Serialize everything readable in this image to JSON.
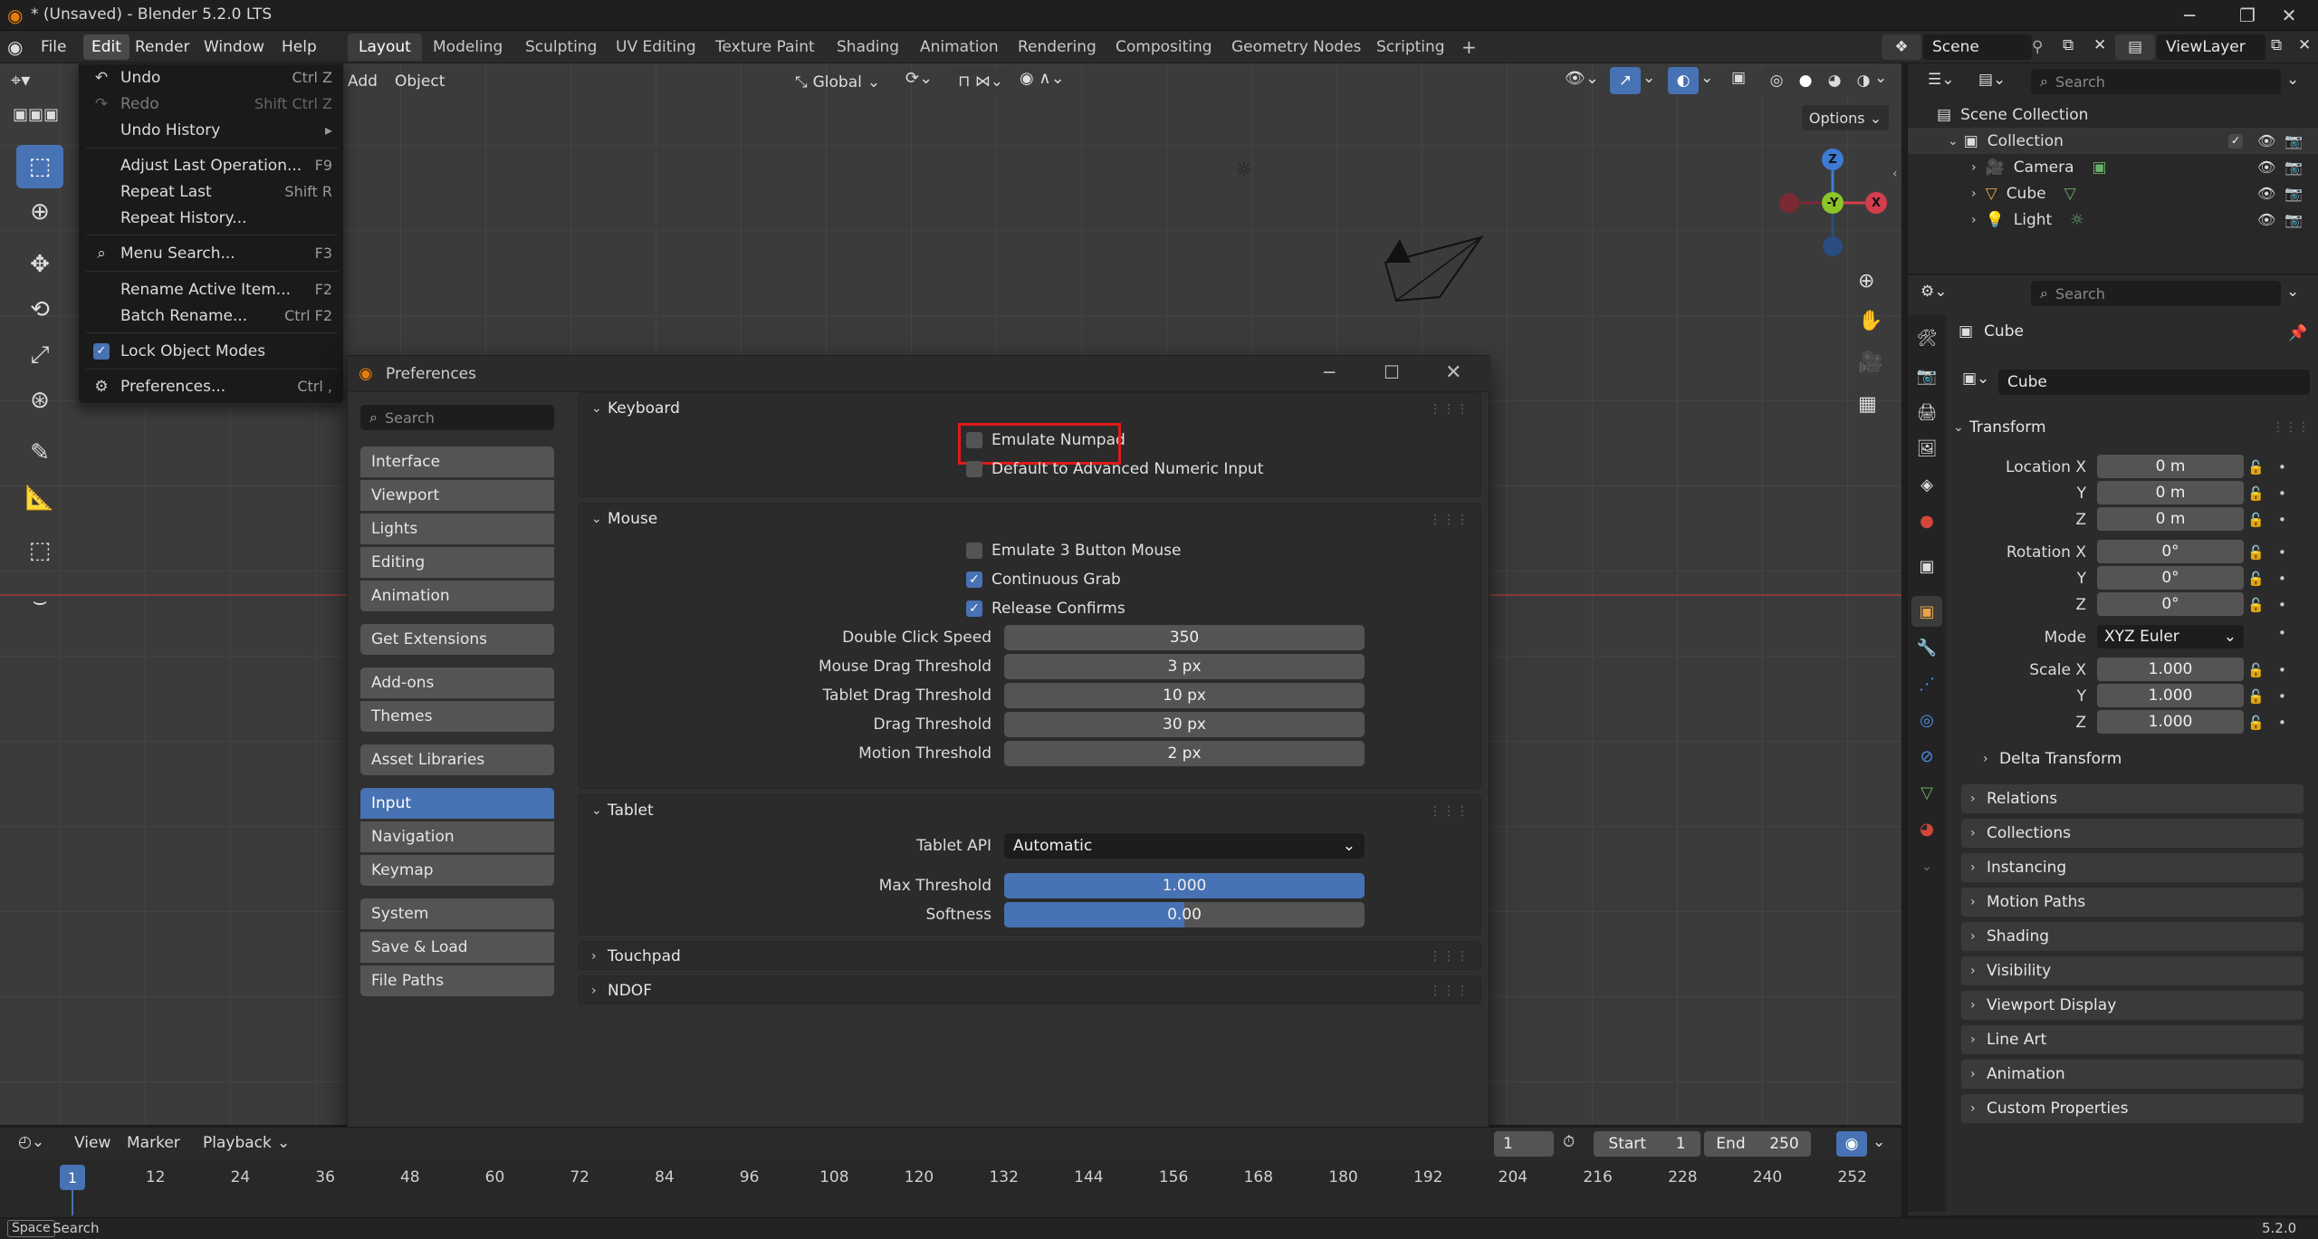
{
  "window": {
    "title": "* (Unsaved) - Blender 5.2.0 LTS"
  },
  "menubar": {
    "items": [
      "File",
      "Edit",
      "Render",
      "Window",
      "Help"
    ]
  },
  "workspaces": [
    "Layout",
    "Modeling",
    "Sculpting",
    "UV Editing",
    "Texture Paint",
    "Shading",
    "Animation",
    "Rendering",
    "Compositing",
    "Geometry Nodes",
    "Scripting"
  ],
  "scene": {
    "name": "Scene",
    "view_layer": "ViewLayer"
  },
  "viewport": {
    "header_menus": [
      "Add",
      "Object"
    ],
    "transform_orientation": "Global",
    "options_label": "Options",
    "gizmo": {
      "z": "Z",
      "y": "-Y",
      "x": "X"
    }
  },
  "edit_menu": {
    "items": [
      {
        "label": "Undo",
        "shortcut": "Ctrl Z",
        "icon": "undo-icon"
      },
      {
        "label": "Redo",
        "shortcut": "Shift Ctrl Z",
        "icon": "redo-icon",
        "disabled": true
      },
      {
        "label": "Undo History",
        "shortcut": "▸"
      },
      {
        "label": "Adjust Last Operation...",
        "shortcut": "F9"
      },
      {
        "label": "Repeat Last",
        "shortcut": "Shift R"
      },
      {
        "label": "Repeat History...",
        "shortcut": ""
      },
      {
        "label": "Menu Search...",
        "shortcut": "F3",
        "icon": "search-icon"
      },
      {
        "label": "Rename Active Item...",
        "shortcut": "F2"
      },
      {
        "label": "Batch Rename...",
        "shortcut": "Ctrl F2"
      },
      {
        "label": "Lock Object Modes",
        "shortcut": "",
        "icon": "checkbox-checked-icon"
      },
      {
        "label": "Preferences...",
        "shortcut": "Ctrl ,",
        "icon": "gear-icon"
      }
    ]
  },
  "preferences": {
    "title": "Preferences",
    "search_placeholder": "Search",
    "nav": {
      "group1": [
        "Interface",
        "Viewport",
        "Lights",
        "Editing",
        "Animation"
      ],
      "group2": [
        "Get Extensions"
      ],
      "group3": [
        "Add-ons",
        "Themes"
      ],
      "group4": [
        "Asset Libraries"
      ],
      "group5": [
        "Input",
        "Navigation",
        "Keymap"
      ],
      "group6": [
        "System",
        "Save & Load",
        "File Paths"
      ],
      "selected": "Input"
    },
    "keyboard": {
      "header": "Keyboard",
      "emulate_numpad": {
        "label": "Emulate Numpad",
        "checked": false
      },
      "adv_numeric": {
        "label": "Default to Advanced Numeric Input",
        "checked": false
      }
    },
    "mouse": {
      "header": "Mouse",
      "emulate_3btn": {
        "label": "Emulate 3 Button Mouse",
        "checked": false
      },
      "continuous_grab": {
        "label": "Continuous Grab",
        "checked": true
      },
      "release_confirms": {
        "label": "Release Confirms",
        "checked": true
      },
      "fields": [
        {
          "label": "Double Click Speed",
          "value": "350"
        },
        {
          "label": "Mouse Drag Threshold",
          "value": "3 px"
        },
        {
          "label": "Tablet Drag Threshold",
          "value": "10 px"
        },
        {
          "label": "Drag Threshold",
          "value": "30 px"
        },
        {
          "label": "Motion Threshold",
          "value": "2 px"
        }
      ]
    },
    "tablet": {
      "header": "Tablet",
      "api_label": "Tablet API",
      "api_value": "Automatic",
      "max_threshold": {
        "label": "Max Threshold",
        "value": "1.000",
        "fill": 1.0
      },
      "softness": {
        "label": "Softness",
        "value": "0.00",
        "fill": 0.5
      }
    },
    "touchpad": {
      "header": "Touchpad"
    },
    "ndof": {
      "header": "NDOF"
    }
  },
  "outliner": {
    "search_placeholder": "Search",
    "root": "Scene Collection",
    "collection": "Collection",
    "objects": [
      "Camera",
      "Cube",
      "Light"
    ]
  },
  "properties": {
    "search_placeholder": "Search",
    "object_name": "Cube",
    "object_field": "Cube",
    "transform_header": "Transform",
    "location": {
      "label_x": "Location X",
      "x": "0 m",
      "y": "0 m",
      "z": "0 m"
    },
    "rotation": {
      "label_x": "Rotation X",
      "x": "0°",
      "y": "0°",
      "z": "0°"
    },
    "mode_label": "Mode",
    "mode_value": "XYZ Euler",
    "scale": {
      "label_x": "Scale X",
      "x": "1.000",
      "y": "1.000",
      "z": "1.000"
    },
    "axis_y": "Y",
    "axis_z": "Z",
    "delta": "Delta Transform",
    "panels": [
      "Relations",
      "Collections",
      "Instancing",
      "Motion Paths",
      "Shading",
      "Visibility",
      "Viewport Display",
      "Line Art",
      "Animation",
      "Custom Properties"
    ]
  },
  "timeline": {
    "menus": [
      "View",
      "Marker",
      "Playback"
    ],
    "current_frame": "1",
    "start_label": "Start",
    "start": "1",
    "end_label": "End",
    "end": "250",
    "frames": [
      "12",
      "24",
      "36",
      "48",
      "60",
      "72",
      "84",
      "96",
      "108",
      "120",
      "132",
      "144",
      "156",
      "168",
      "180",
      "192",
      "204",
      "216",
      "228",
      "240",
      "252"
    ],
    "playhead": "1"
  },
  "statusbar": {
    "key": "Space",
    "action": "Search",
    "version": "5.2.0"
  }
}
